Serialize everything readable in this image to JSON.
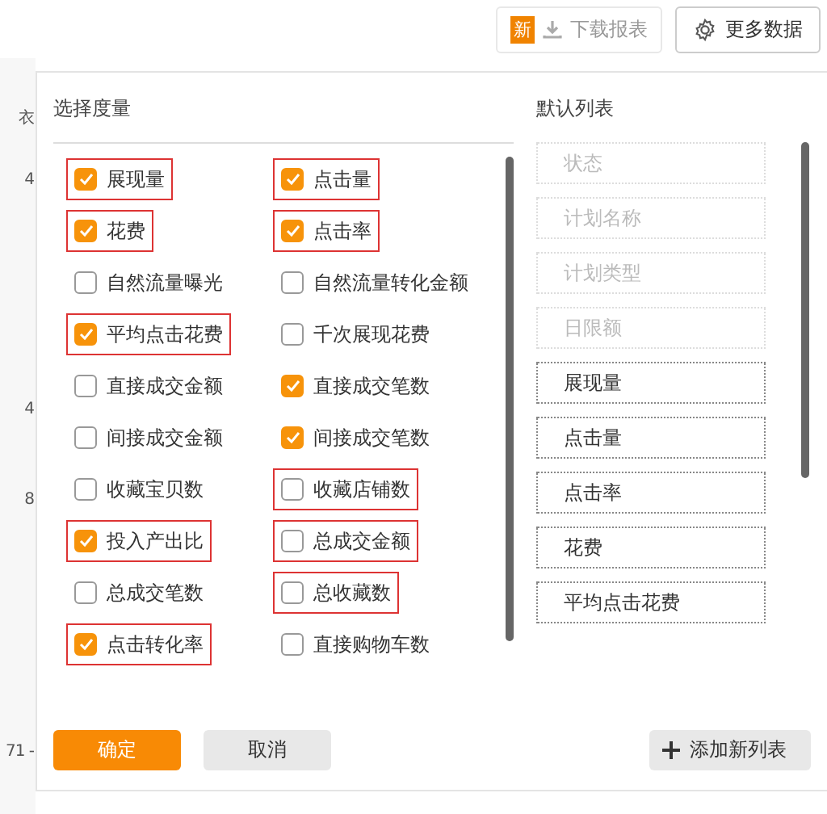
{
  "toolbar": {
    "new_badge": "新",
    "download_button": "下载报表",
    "more_button": "更多数据"
  },
  "background_rows": [
    "衣",
    "4",
    "4",
    "8",
    "71 -"
  ],
  "metrics": {
    "title": "选择度量",
    "items": [
      {
        "label": "展现量",
        "checked": true,
        "highlighted": true
      },
      {
        "label": "点击量",
        "checked": true,
        "highlighted": true
      },
      {
        "label": "花费",
        "checked": true,
        "highlighted": true
      },
      {
        "label": "点击率",
        "checked": true,
        "highlighted": true
      },
      {
        "label": "自然流量曝光",
        "checked": false,
        "highlighted": false
      },
      {
        "label": "自然流量转化金额",
        "checked": false,
        "highlighted": false
      },
      {
        "label": "平均点击花费",
        "checked": true,
        "highlighted": true
      },
      {
        "label": "千次展现花费",
        "checked": false,
        "highlighted": false
      },
      {
        "label": "直接成交金额",
        "checked": false,
        "highlighted": false
      },
      {
        "label": "直接成交笔数",
        "checked": true,
        "highlighted": false
      },
      {
        "label": "间接成交金额",
        "checked": false,
        "highlighted": false
      },
      {
        "label": "间接成交笔数",
        "checked": true,
        "highlighted": false
      },
      {
        "label": "收藏宝贝数",
        "checked": false,
        "highlighted": false
      },
      {
        "label": "收藏店铺数",
        "checked": false,
        "highlighted": true
      },
      {
        "label": "投入产出比",
        "checked": true,
        "highlighted": true
      },
      {
        "label": "总成交金额",
        "checked": false,
        "highlighted": true
      },
      {
        "label": "总成交笔数",
        "checked": false,
        "highlighted": false
      },
      {
        "label": "总收藏数",
        "checked": false,
        "highlighted": true
      },
      {
        "label": "点击转化率",
        "checked": true,
        "highlighted": true
      },
      {
        "label": "直接购物车数",
        "checked": false,
        "highlighted": false
      }
    ]
  },
  "default_list": {
    "title": "默认列表",
    "items": [
      {
        "label": "状态",
        "disabled": true
      },
      {
        "label": "计划名称",
        "disabled": true
      },
      {
        "label": "计划类型",
        "disabled": true
      },
      {
        "label": "日限额",
        "disabled": true
      },
      {
        "label": "展现量",
        "disabled": false
      },
      {
        "label": "点击量",
        "disabled": false
      },
      {
        "label": "点击率",
        "disabled": false
      },
      {
        "label": "花费",
        "disabled": false
      },
      {
        "label": "平均点击花费",
        "disabled": false
      }
    ]
  },
  "buttons": {
    "confirm": "确定",
    "cancel": "取消",
    "add_list": "添加新列表"
  }
}
